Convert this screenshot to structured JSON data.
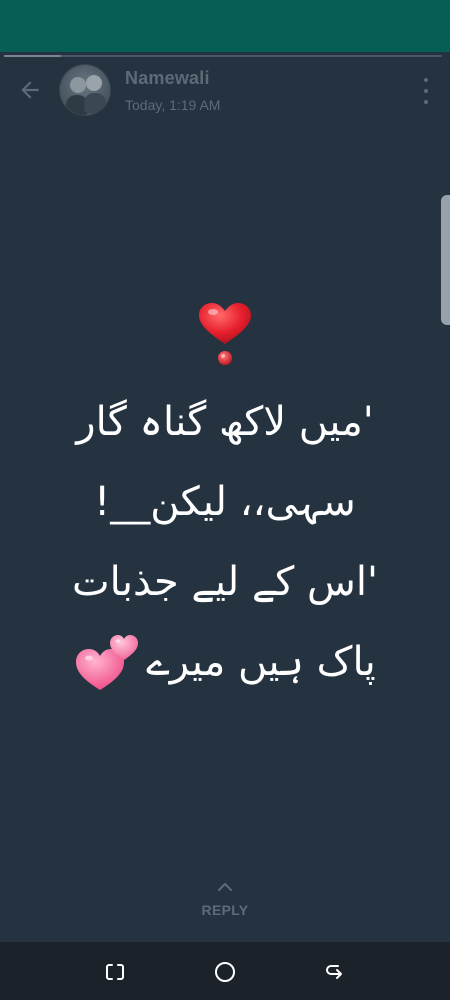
{
  "colors": {
    "status_bar": "#075e54",
    "background": "#253341",
    "muted_text": "#5d6b78",
    "status_text": "#ffffff",
    "nav_bar": "#1b2229"
  },
  "header": {
    "contact_name": "Namewali",
    "timestamp": "Today, 1:19 AM",
    "back_icon": "arrow-left-icon",
    "menu_icon": "more-vertical-icon"
  },
  "progress": {
    "segments": 1,
    "fill_fraction": 0.13
  },
  "status": {
    "lines": [
      "'میں لاکھ گناہ گار",
      "سہی،، لیکن__!",
      "'اس کے لیے جذبات",
      "پاک ہیں میرے"
    ],
    "top_emoji": "heart-exclamation-icon",
    "end_emoji": "two-hearts-icon"
  },
  "reply": {
    "label": "REPLY",
    "icon": "chevron-up-icon"
  },
  "nav": {
    "recents_icon": "recents-icon",
    "home_icon": "home-icon",
    "back_icon": "back-icon"
  }
}
